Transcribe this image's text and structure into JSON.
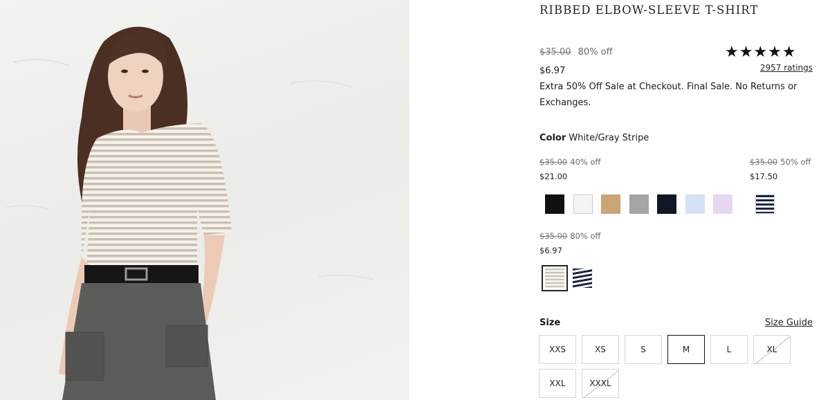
{
  "product": {
    "title": "RIBBED ELBOW-SLEEVE T-SHIRT",
    "orig_price": "$35.00",
    "discount": "80% off",
    "sale_price": "$6.97",
    "rating": {
      "stars": "★★★★★",
      "value": 4.8,
      "count_label": "2957 ratings"
    },
    "promo": "Extra 50% Off Sale at Checkout. Final Sale. No Returns or Exchanges."
  },
  "color": {
    "label": "Color",
    "selected": "White/Gray Stripe",
    "groups": [
      {
        "orig": "$35.00",
        "off": "40% off",
        "now": "$21.00",
        "swatches": [
          "black",
          "white",
          "tan",
          "gray",
          "navy",
          "light-blue",
          "lavender"
        ]
      },
      {
        "orig": "$35.00",
        "off": "50% off",
        "now": "$17.50",
        "swatches": [
          "navy-white-stripe"
        ]
      },
      {
        "orig": "$35.00",
        "off": "80% off",
        "now": "$6.97",
        "swatches": [
          "white-gray-stripe",
          "navy-white-stripe-2"
        ]
      }
    ],
    "swatch_colors": {
      "black": "#111111",
      "white": "#f4f4f4",
      "tan": "#c8a477",
      "gray": "#a4a6a2",
      "navy": "#101726",
      "light-blue": "#d5e2f5",
      "lavender": "#e6d6f2",
      "stripe_dark": "#1b2340",
      "stripe_light": "#ffffff",
      "stripe_gray": "#c9c2b8"
    }
  },
  "size": {
    "label": "Size",
    "guide_label": "Size Guide",
    "options": [
      {
        "label": "XXS",
        "available": true
      },
      {
        "label": "XS",
        "available": true
      },
      {
        "label": "S",
        "available": true
      },
      {
        "label": "M",
        "available": true,
        "selected": true
      },
      {
        "label": "L",
        "available": true
      },
      {
        "label": "XL",
        "available": false
      },
      {
        "label": "XXL",
        "available": true
      },
      {
        "label": "XXXL",
        "available": false
      }
    ]
  }
}
